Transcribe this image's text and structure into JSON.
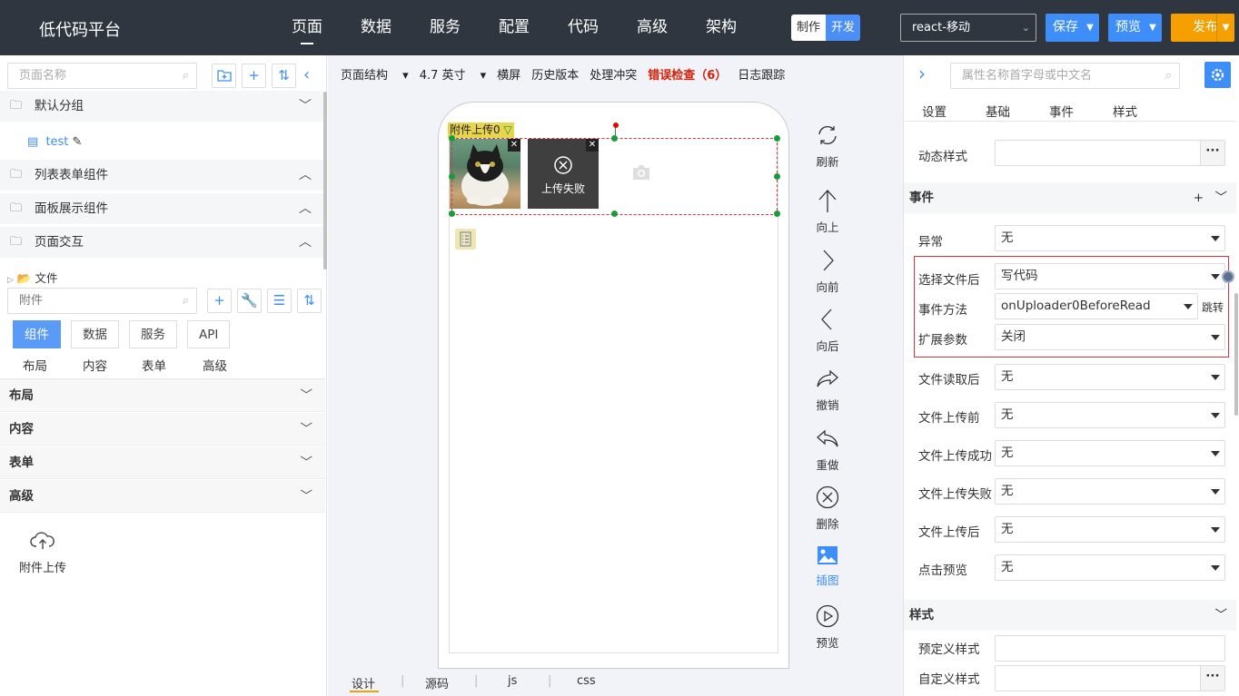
{
  "app": {
    "title": "低代码平台"
  },
  "nav": {
    "items": [
      "页面",
      "数据",
      "服务",
      "配置",
      "代码",
      "高级",
      "架构"
    ],
    "active": "页面"
  },
  "mode": {
    "make": "制作",
    "dev": "开发"
  },
  "project_select": {
    "value": "react-移动"
  },
  "buttons": {
    "save": "保存",
    "preview": "预览",
    "publish": "发布"
  },
  "left": {
    "page_search_placeholder": "页面名称",
    "groups": [
      "默认分组",
      "列表表单组件",
      "面板展示组件",
      "页面交互"
    ],
    "page_item": "test",
    "file_row": "文件",
    "widget_search_placeholder": "附件",
    "tabs": [
      "组件",
      "数据",
      "服务",
      "API"
    ],
    "subtabs": [
      "布局",
      "内容",
      "表单",
      "高级"
    ],
    "categories": [
      "布局",
      "内容",
      "表单",
      "高级"
    ],
    "widget": {
      "label": "附件上传",
      "icon": "cloud-upload-icon"
    }
  },
  "center": {
    "toolbar": {
      "structure": "页面结构",
      "size": "4.7 英寸",
      "landscape": "横屏",
      "history": "历史版本",
      "conflict": "处理冲突",
      "error_check": "错误检查（6）",
      "log": "日志跟踪"
    },
    "component_tag": "附件上传0",
    "upload_fail_text": "上传失败",
    "tools": [
      "刷新",
      "向上",
      "向前",
      "向后",
      "撤销",
      "重做",
      "删除",
      "插图",
      "预览"
    ],
    "active_tool": "插图",
    "bottom_tabs": [
      "设计",
      "源码",
      "js",
      "css"
    ]
  },
  "right": {
    "search_placeholder": "属性名称首字母或中文名",
    "tabs": [
      "设置",
      "基础",
      "事件",
      "样式"
    ],
    "dynamic_style_label": "动态样式",
    "events_title": "事件",
    "events_plus": "+",
    "rows": [
      {
        "label": "异常",
        "value": "无"
      },
      {
        "label": "选择文件后",
        "value": "写代码"
      },
      {
        "label": "事件方法",
        "value": "onUploader0BeforeRead",
        "extra": "跳转"
      },
      {
        "label": "扩展参数",
        "value": "关闭"
      },
      {
        "label": "文件读取后",
        "value": "无"
      },
      {
        "label": "文件上传前",
        "value": "无"
      },
      {
        "label": "文件上传成功",
        "value": "无"
      },
      {
        "label": "文件上传失败",
        "value": "无"
      },
      {
        "label": "文件上传后",
        "value": "无"
      },
      {
        "label": "点击预览",
        "value": "无"
      }
    ],
    "style_title": "样式",
    "predefined_style_label": "预定义样式",
    "custom_style_label": "自定义样式"
  },
  "colors": {
    "topbar": "#2f3640",
    "accent": "#3d8ef8",
    "publish": "#f5a000",
    "error": "#d81e06"
  }
}
